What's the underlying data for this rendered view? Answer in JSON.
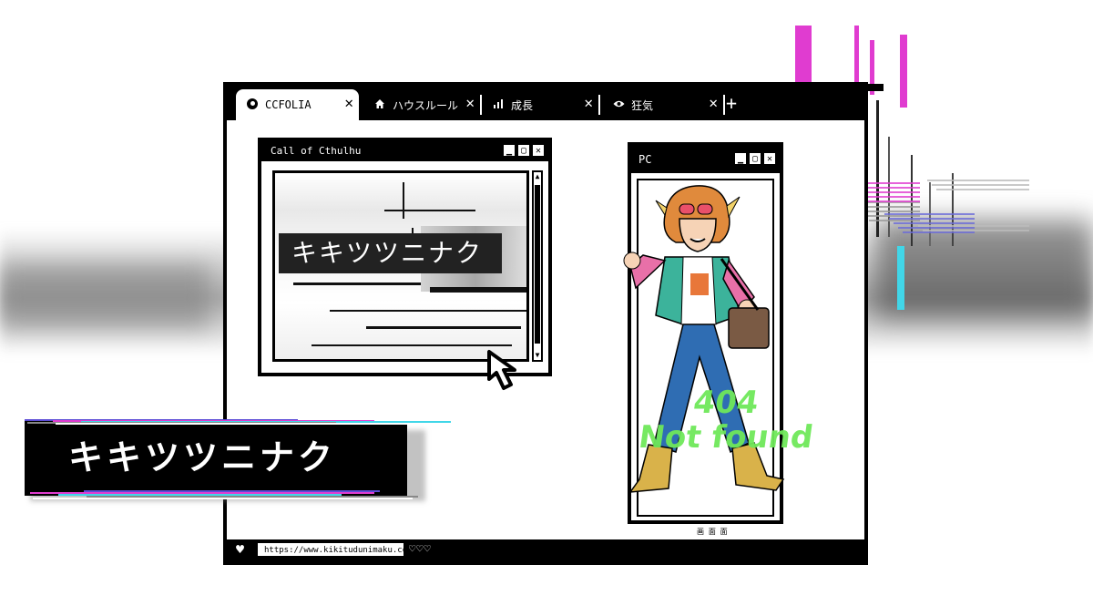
{
  "browser": {
    "tabs": [
      {
        "label": "CCFOLIA",
        "icon": "ccfolia-logo-icon",
        "active": true
      },
      {
        "label": "ハウスルール",
        "icon": "home-icon",
        "active": false
      },
      {
        "label": "成長",
        "icon": "bar-chart-icon",
        "active": false
      },
      {
        "label": "狂気",
        "icon": "eye-icon",
        "active": false
      }
    ],
    "close_glyph": "✕",
    "new_tab_glyph": "+",
    "url": "https://www.kikitudunimaku.com/",
    "status_heart": "♥",
    "hearts": "♡♡♡",
    "status_glyph": "画 面 面"
  },
  "coc_window": {
    "title": "Call of Cthulhu",
    "controls": [
      "▁",
      "▢",
      "✕"
    ],
    "logo_text": "キキツツニナク",
    "scroll_up": "▲",
    "scroll_down": "▼"
  },
  "pc_window": {
    "title": "PC",
    "controls": [
      "▁",
      "▢",
      "✕"
    ],
    "error_line1": "404",
    "error_line2": "Not found"
  },
  "banner": {
    "text": "キキツツニナク"
  },
  "colors": {
    "accent_magenta": "#e03cd0",
    "accent_cyan": "#41d6e8",
    "error_green": "#6fe85a"
  }
}
